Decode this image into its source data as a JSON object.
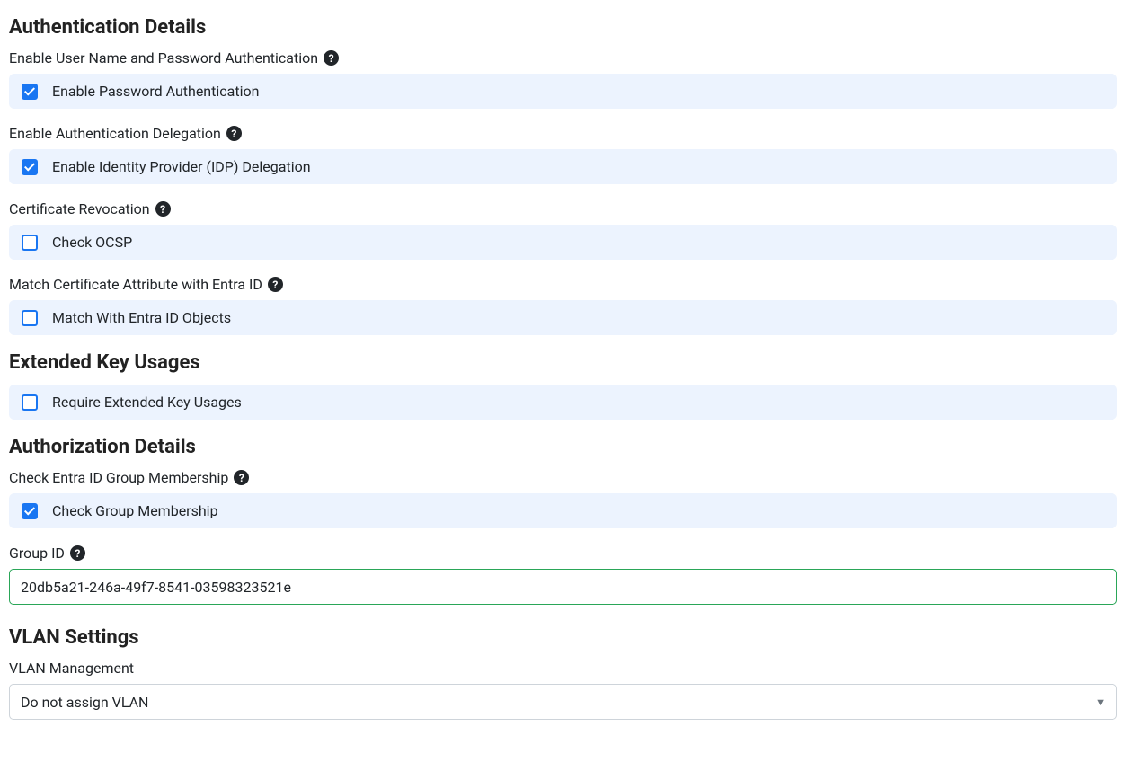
{
  "sections": {
    "auth_details": {
      "heading": "Authentication Details",
      "fields": {
        "username_password": {
          "label": "Enable User Name and Password Authentication",
          "checkbox_label": "Enable Password Authentication",
          "checked": true
        },
        "auth_delegation": {
          "label": "Enable Authentication Delegation",
          "checkbox_label": "Enable Identity Provider (IDP) Delegation",
          "checked": true
        },
        "cert_revocation": {
          "label": "Certificate Revocation",
          "checkbox_label": "Check OCSP",
          "checked": false
        },
        "match_cert_attr": {
          "label": "Match Certificate Attribute with Entra ID",
          "checkbox_label": "Match With Entra ID Objects",
          "checked": false
        }
      }
    },
    "ext_key_usages": {
      "heading": "Extended Key Usages",
      "fields": {
        "require_eku": {
          "checkbox_label": "Require Extended Key Usages",
          "checked": false
        }
      }
    },
    "authz_details": {
      "heading": "Authorization Details",
      "fields": {
        "check_group": {
          "label": "Check Entra ID Group Membership",
          "checkbox_label": "Check Group Membership",
          "checked": true
        },
        "group_id": {
          "label": "Group ID",
          "value": "20db5a21-246a-49f7-8541-03598323521e"
        }
      }
    },
    "vlan_settings": {
      "heading": "VLAN Settings",
      "fields": {
        "vlan_mgmt": {
          "label": "VLAN Management",
          "selected": "Do not assign VLAN"
        }
      }
    }
  }
}
